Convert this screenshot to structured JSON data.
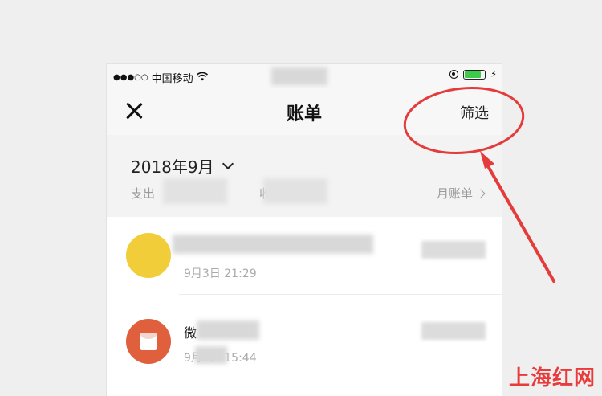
{
  "status_bar": {
    "signal": "●●●○○",
    "carrier": "中国移动",
    "wifi_icon": "wifi-icon",
    "battery_level": 0.75,
    "battery_color": "#3ecb4a"
  },
  "nav": {
    "title": "账单",
    "filter_label": "筛选",
    "close_icon": "close-icon"
  },
  "summary": {
    "month_label": "2018年9月",
    "expense_label": "支出",
    "income_label": "收入",
    "monthly_bill_label": "月账单"
  },
  "transactions": [
    {
      "title": "",
      "time": "9月3日 21:29",
      "icon": "merchant-avatar-icon",
      "icon_color": "#f2cd3a"
    },
    {
      "title": "微",
      "time": "9月3日 15:44",
      "icon": "red-packet-icon",
      "icon_color": "#e0603d"
    }
  ],
  "annotation": {
    "color": "#e43b3b"
  },
  "watermark": "上海红网"
}
